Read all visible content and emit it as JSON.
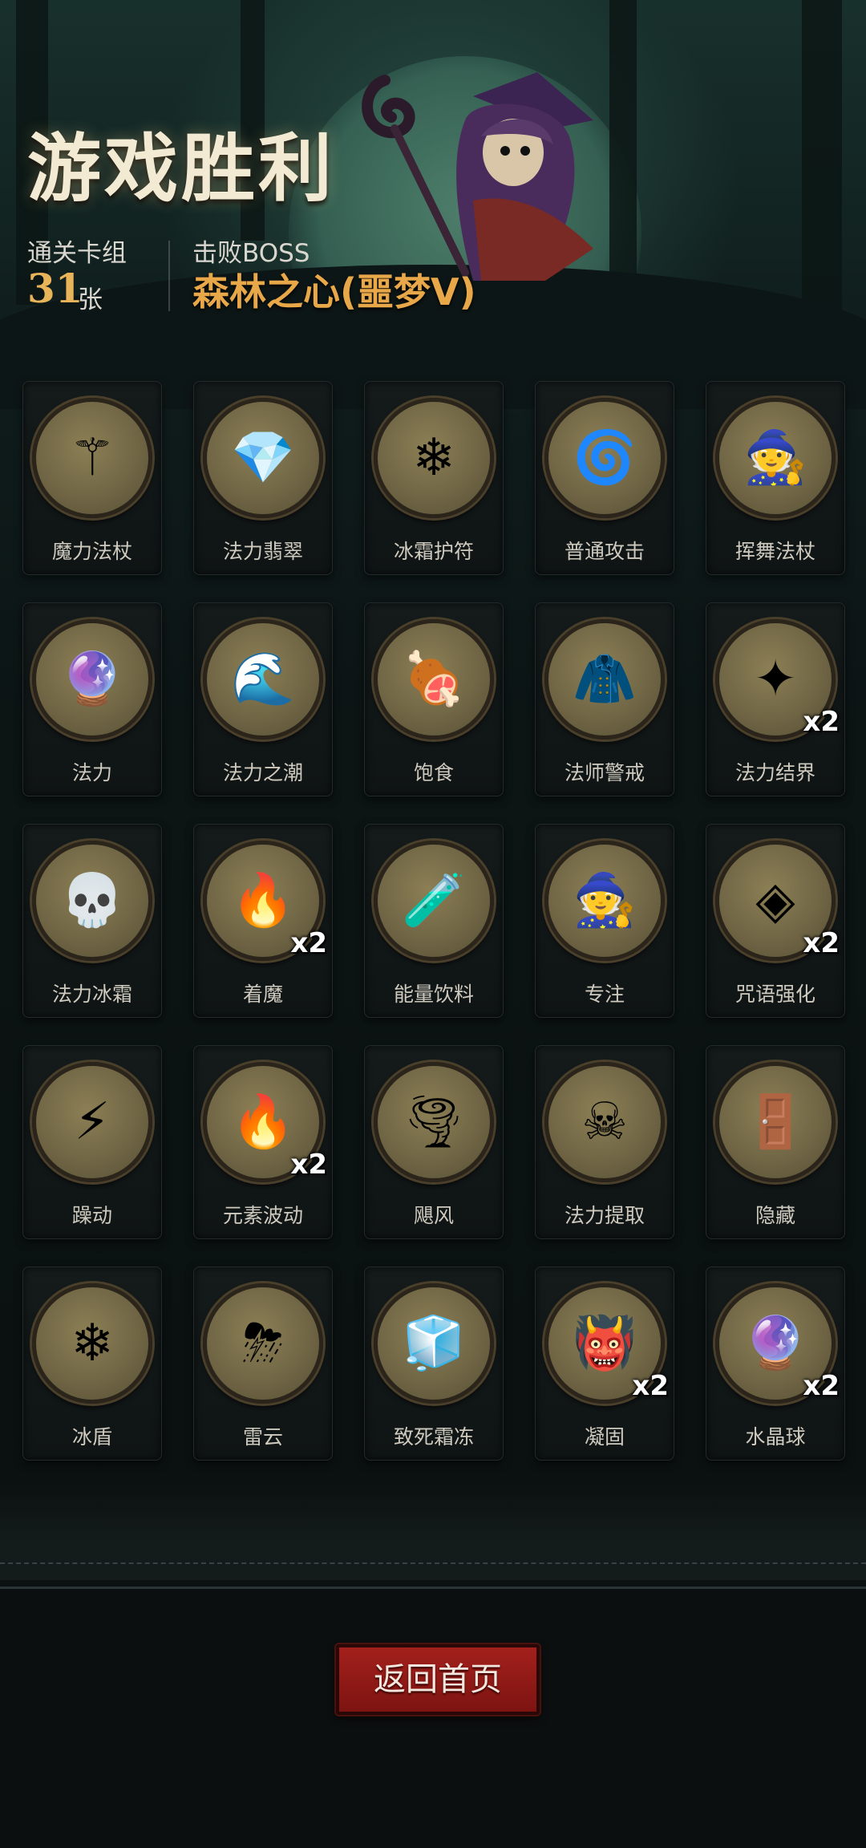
{
  "title": "游戏胜利",
  "stats": {
    "deck_label": "通关卡组",
    "deck_count": "31",
    "deck_unit": "张",
    "boss_label": "击败BOSS",
    "boss_name": "森林之心(噩梦V)"
  },
  "cards": [
    {
      "name": "魔力法杖",
      "icon": "magic-staff-icon",
      "count": ""
    },
    {
      "name": "法力翡翠",
      "icon": "emerald-icon",
      "count": ""
    },
    {
      "name": "冰霜护符",
      "icon": "frost-amulet-icon",
      "count": ""
    },
    {
      "name": "普通攻击",
      "icon": "spiral-staff-icon",
      "count": ""
    },
    {
      "name": "挥舞法杖",
      "icon": "swinging-mage-icon",
      "count": ""
    },
    {
      "name": "法力",
      "icon": "mana-orb-icon",
      "count": ""
    },
    {
      "name": "法力之潮",
      "icon": "mana-tide-icon",
      "count": ""
    },
    {
      "name": "饱食",
      "icon": "full-belly-icon",
      "count": ""
    },
    {
      "name": "法师警戒",
      "icon": "hooded-mage-icon",
      "count": ""
    },
    {
      "name": "法力结界",
      "icon": "mana-barrier-icon",
      "count": "x2"
    },
    {
      "name": "法力冰霜",
      "icon": "frost-skull-icon",
      "count": ""
    },
    {
      "name": "着魔",
      "icon": "possessed-icon",
      "count": "x2"
    },
    {
      "name": "能量饮料",
      "icon": "energy-drink-icon",
      "count": ""
    },
    {
      "name": "专注",
      "icon": "old-wizard-icon",
      "count": ""
    },
    {
      "name": "咒语强化",
      "icon": "spell-crystal-icon",
      "count": "x2"
    },
    {
      "name": "躁动",
      "icon": "frenzy-icon",
      "count": ""
    },
    {
      "name": "元素波动",
      "icon": "elemental-wave-icon",
      "count": "x2"
    },
    {
      "name": "飓风",
      "icon": "tornado-icon",
      "count": ""
    },
    {
      "name": "法力提取",
      "icon": "mana-skull-icon",
      "count": ""
    },
    {
      "name": "隐藏",
      "icon": "hiding-goblin-icon",
      "count": ""
    },
    {
      "name": "冰盾",
      "icon": "ice-shield-icon",
      "count": ""
    },
    {
      "name": "雷云",
      "icon": "thundercloud-icon",
      "count": ""
    },
    {
      "name": "致死霜冻",
      "icon": "frozen-skeleton-icon",
      "count": ""
    },
    {
      "name": "凝固",
      "icon": "petrified-troll-icon",
      "count": "x2"
    },
    {
      "name": "水晶球",
      "icon": "crystal-ball-icon",
      "count": "x2"
    }
  ],
  "icon_glyphs": {
    "magic-staff-icon": "⚚",
    "emerald-icon": "💎",
    "frost-amulet-icon": "❄",
    "spiral-staff-icon": "🌀",
    "swinging-mage-icon": "🧙",
    "mana-orb-icon": "🔮",
    "mana-tide-icon": "🌊",
    "full-belly-icon": "🍖",
    "hooded-mage-icon": "🧥",
    "mana-barrier-icon": "✦",
    "frost-skull-icon": "💀",
    "possessed-icon": "🔥",
    "energy-drink-icon": "🧪",
    "old-wizard-icon": "🧙",
    "spell-crystal-icon": "◈",
    "frenzy-icon": "⚡",
    "elemental-wave-icon": "🔥",
    "tornado-icon": "🌪",
    "mana-skull-icon": "☠",
    "hiding-goblin-icon": "🚪",
    "ice-shield-icon": "❄",
    "thundercloud-icon": "⛈",
    "frozen-skeleton-icon": "🧊",
    "petrified-troll-icon": "👹",
    "crystal-ball-icon": "🔮"
  },
  "buttons": {
    "home": "返回首页"
  },
  "colors": {
    "accent": "#e8a849",
    "button": "#a3201c"
  }
}
